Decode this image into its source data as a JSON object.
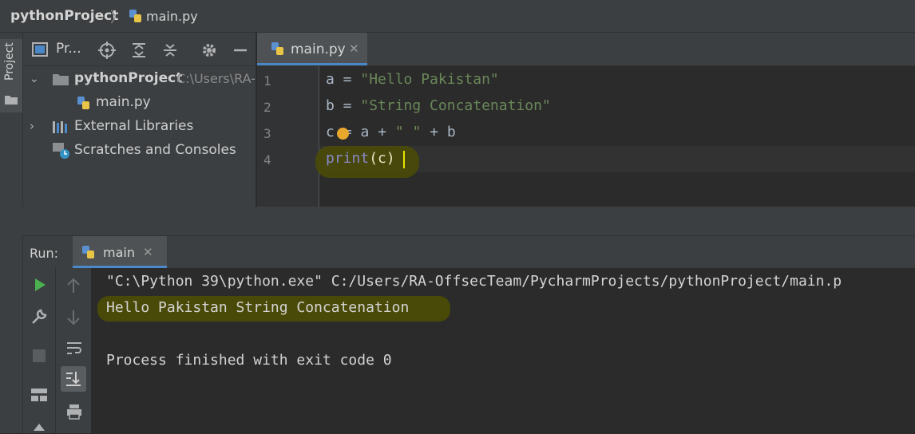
{
  "breadcrumb": {
    "project": "pythonProject",
    "separator": "〉",
    "file": "main.py"
  },
  "stripe": {
    "project_label": "Project"
  },
  "project_panel": {
    "view_label": "Pr...",
    "tree": [
      {
        "label": "pythonProject",
        "hint": "C:\\Users\\RA-"
      },
      {
        "label": "main.py"
      },
      {
        "label": "External Libraries"
      },
      {
        "label": "Scratches and Consoles"
      }
    ]
  },
  "editor": {
    "tab_label": "main.py",
    "tab_close": "✕",
    "line_numbers": [
      "1",
      "2",
      "3",
      "4"
    ],
    "lines": [
      {
        "a": "a = ",
        "b": "\"Hello Pakistan\""
      },
      {
        "a": "b = ",
        "b": "\"String Concatenation\""
      },
      {
        "a": "c",
        "b": "= a + ",
        "c": "\" \"",
        "d": " + b"
      },
      {
        "a": "print",
        "b": "(c)"
      }
    ]
  },
  "run": {
    "label": "Run:",
    "tab_label": "main",
    "tab_close": "✕",
    "output": [
      "\"C:\\Python 39\\python.exe\" C:/Users/RA-OffsecTeam/PycharmProjects/pythonProject/main.p",
      "Hello Pakistan String Concatenation",
      "",
      "Process finished with exit code 0"
    ]
  },
  "colors": {
    "accent": "#4a88c7",
    "string": "#6a8759",
    "builtin": "#8888c6",
    "highlight": "#4a4a08",
    "run_green": "#4caf50"
  },
  "icons": [
    "python-file-icon",
    "folder-icon",
    "libraries-icon",
    "scratches-icon",
    "target-icon",
    "expand-all-icon",
    "collapse-all-icon",
    "gear-icon",
    "minimize-icon",
    "run-icon",
    "wrench-icon",
    "stop-icon",
    "up-arrow-icon",
    "down-arrow-icon",
    "soft-wrap-icon",
    "scroll-to-end-icon",
    "print-icon",
    "layout-icon",
    "pin-icon",
    "bulb-icon"
  ]
}
